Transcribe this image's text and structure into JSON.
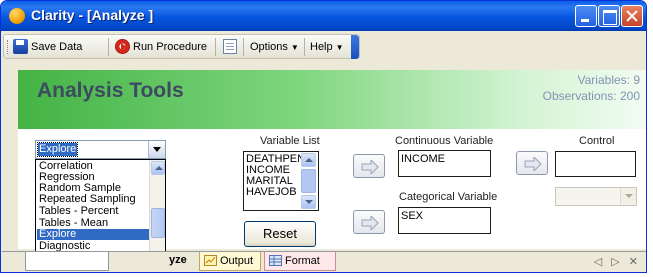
{
  "window": {
    "title": "Clarity - [Analyze ]"
  },
  "toolbar": {
    "save_label": "Save Data",
    "run_label": "Run Procedure",
    "options_label": "Options",
    "help_label": "Help"
  },
  "panel": {
    "title": "Analysis Tools",
    "variables_count": "Variables: 9",
    "observations_count": "Observations: 200"
  },
  "procedure_select": {
    "selected": "Explore",
    "options": [
      "Correlation",
      "Regression",
      "Random Sample",
      "Repeated Sampling",
      "Tables - Percent",
      "Tables - Mean",
      "Explore",
      "Diagnostic"
    ],
    "highlighted_index": 6
  },
  "variable_list": {
    "label": "Variable List",
    "items": [
      "DEATHPEN",
      "INCOME",
      "MARITAL",
      "HAVEJOB"
    ]
  },
  "reset_label": "Reset",
  "continuous": {
    "label": "Continuous Variable",
    "value": "INCOME"
  },
  "categorical": {
    "label": "Categorical Variable",
    "value": "SEX"
  },
  "control": {
    "label": "Control",
    "value": ""
  },
  "tabs": [
    {
      "label": "Analyze",
      "visible_text": "yze",
      "active": true
    },
    {
      "label": "Output",
      "active": false
    },
    {
      "label": "Format",
      "active": false
    }
  ],
  "tab_nav": "◁ ▷ ✕",
  "colors": {
    "title_bar": "#0655e0",
    "header_green": "#44b344",
    "selection_blue": "#316ac5"
  }
}
